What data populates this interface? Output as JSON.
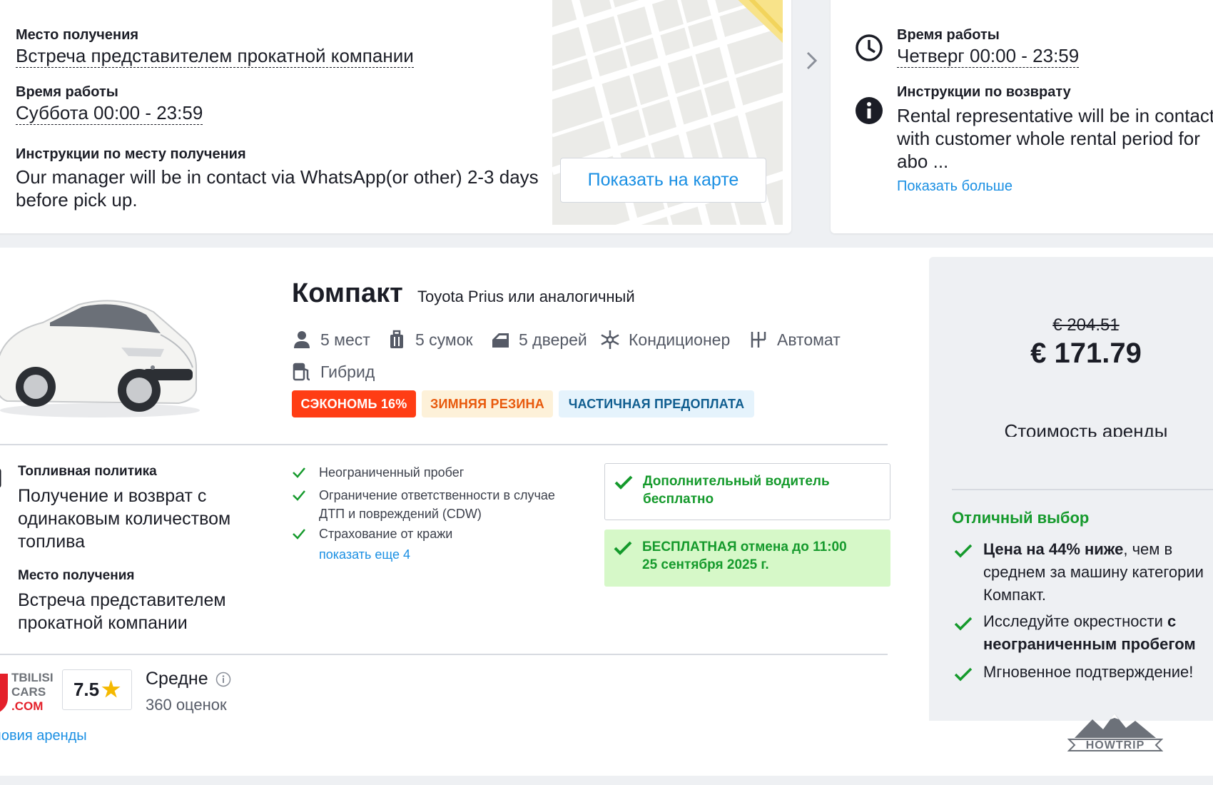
{
  "pickup": {
    "location_label": "Место получения",
    "location_value": "Встреча представителем прокатной компании",
    "hours_label": "Время работы",
    "hours_value": "Суббота 00:00 - 23:59",
    "instructions_label": "Инструкции по месту получения",
    "instructions_line1": "Our manager will be in contact via WhatsApp(or other) 2-3 days",
    "instructions_line2": "before pick up.",
    "map_button": "Показать на карте"
  },
  "return": {
    "hours_label": "Время работы",
    "hours_value": "Четверг 00:00 - 23:59",
    "instructions_label": "Инструкции по возврату",
    "instructions_line1": "Rental representative will be in contact",
    "instructions_line2": "with customer whole rental period for",
    "instructions_line3": "abo ...",
    "show_more": "Показать больше"
  },
  "car": {
    "category": "Компакт",
    "model": "Toyota Prius или аналогичный",
    "specs": {
      "seats": "5 мест",
      "bags": "5 сумок",
      "doors": "5 дверей",
      "ac": "Кондиционер",
      "transmission": "Автомат",
      "fuel": "Гибрид"
    },
    "badges": {
      "save": "СЭКОНОМЬ 16%",
      "winter": "ЗИМНЯЯ РЕЗИНА",
      "prepay": "ЧАСТИЧНАЯ ПРЕДОПЛАТА"
    },
    "fuel_policy_label": "Топливная политика",
    "fuel_policy_line1": "Получение и возврат с",
    "fuel_policy_line2": "одинаковым количеством",
    "fuel_policy_line3": "топлива",
    "pickup_label": "Место получения",
    "pickup_line1": "Встреча представителем",
    "pickup_line2": "прокатной компании",
    "features": {
      "mileage": "Неограниченный пробег",
      "cdw_line1": "Ограничение ответственности в случае",
      "cdw_line2": "ДТП и повреждений (CDW)",
      "theft": "Страхование от кражи",
      "more": "показать еще 4"
    },
    "extra_driver_line1": "Дополнительный водитель",
    "extra_driver_line2": "бесплатно",
    "free_cancel_line1": "БЕСПЛАТНАЯ отмена до 11:00",
    "free_cancel_line2": "25 сентября 2025 г.",
    "supplier": {
      "logo_line1": "TBILISI",
      "logo_line2": "CARS",
      "logo_line3": ".COM",
      "score": "7.5",
      "verdict": "Средне",
      "reviews": "360 оценок",
      "terms_link": "ловия аренды"
    }
  },
  "price": {
    "old": "€ 204.51",
    "new": "€ 171.79",
    "label": "Стоимость аренды",
    "great_choice": "Отличный выбор",
    "b1_bold": "Цена на 44% ниже",
    "b1_rest": ", чем в",
    "b1_line2": "среднем за машину категории",
    "b1_line3": "Компакт.",
    "b2_text": "Исследуйте окрестности ",
    "b2_bold1": "с",
    "b2_bold2": "неограниченным пробегом",
    "b3": "Мгновенное подтверждение!"
  },
  "watermark": "HOWTRIP",
  "colors": {
    "accent_blue": "#1a8fe3",
    "green": "#159a2c",
    "save_red": "#ff3d14",
    "winter_bg": "#fdf1d9",
    "winter_text": "#e8590c",
    "prepay_bg": "#e5f3fc",
    "prepay_text": "#0f5d8f"
  },
  "icons": {
    "clock": "clock-icon",
    "info": "info-icon",
    "chevron": "chevron-right-icon",
    "person": "person-icon",
    "suitcase": "suitcase-icon",
    "door": "car-door-icon",
    "snowflake": "snowflake-icon",
    "gearbox": "gearbox-icon",
    "fuel": "fuel-pump-icon",
    "check": "check-icon",
    "star": "star-icon"
  }
}
